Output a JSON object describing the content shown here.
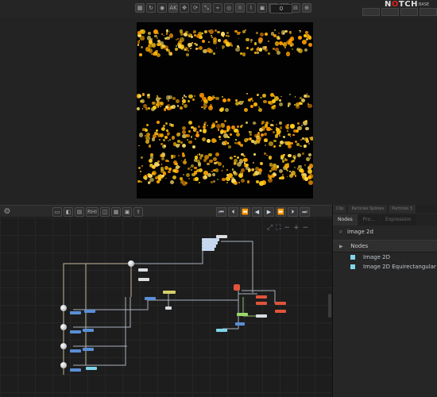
{
  "viewport_toolbar": {
    "frame_value": "0",
    "tools": [
      {
        "icon": "grid-icon"
      },
      {
        "icon": "refresh-icon"
      },
      {
        "icon": "camera-icon"
      },
      {
        "icon": "ak-icon",
        "label": "AK"
      },
      {
        "icon": "move-icon"
      },
      {
        "icon": "rotate-icon"
      },
      {
        "icon": "scale-icon"
      },
      {
        "icon": "snap-icon"
      },
      {
        "icon": "target-icon"
      },
      {
        "icon": "light-icon"
      },
      {
        "icon": "bone-icon"
      },
      {
        "icon": "cube-icon"
      },
      {
        "icon": "lock-icon"
      },
      {
        "icon": "layers-icon"
      },
      {
        "icon": "split-icon"
      },
      {
        "icon": "zoom-icon"
      }
    ],
    "logo_text": "NOTCH",
    "edition_text": "BASE"
  },
  "render": {
    "background": "#020202",
    "particle_colors": [
      "#ffcc1a",
      "#ffb000",
      "#ff9a00",
      "#ffe066"
    ]
  },
  "node_toolbar": {
    "tools": [
      {
        "icon": "select-icon"
      },
      {
        "icon": "color-icon"
      },
      {
        "icon": "map-icon"
      },
      {
        "icon": "rhi-icon",
        "label": "RHI"
      },
      {
        "icon": "node-icon"
      },
      {
        "icon": "grid-icon"
      },
      {
        "icon": "image-icon"
      },
      {
        "icon": "export-icon"
      }
    ],
    "transport": [
      {
        "icon": "skip-start-icon",
        "glyph": "⏮"
      },
      {
        "icon": "prev-key-icon",
        "glyph": "⏴"
      },
      {
        "icon": "step-back-icon",
        "glyph": "⏪"
      },
      {
        "icon": "rewind-icon",
        "glyph": "◀"
      },
      {
        "icon": "play-icon",
        "glyph": "▶"
      },
      {
        "icon": "step-forward-icon",
        "glyph": "⏩"
      },
      {
        "icon": "next-key-icon",
        "glyph": "⏵"
      },
      {
        "icon": "skip-end-icon",
        "glyph": "⏭"
      }
    ]
  },
  "right_panel": {
    "top_tabs": [
      "Clip",
      "Particles Splines",
      "Particles 3"
    ],
    "sub_tabs": [
      "Nodes",
      "Pro...",
      "Expression"
    ],
    "active_sub_tab": "Nodes",
    "search_value": "image 2d",
    "category": "Nodes",
    "items": [
      {
        "label": "Image 2D",
        "color": "#7fd6e8"
      },
      {
        "label": "Image 2D Equirectangular",
        "color": "#7fd6e8"
      }
    ]
  }
}
